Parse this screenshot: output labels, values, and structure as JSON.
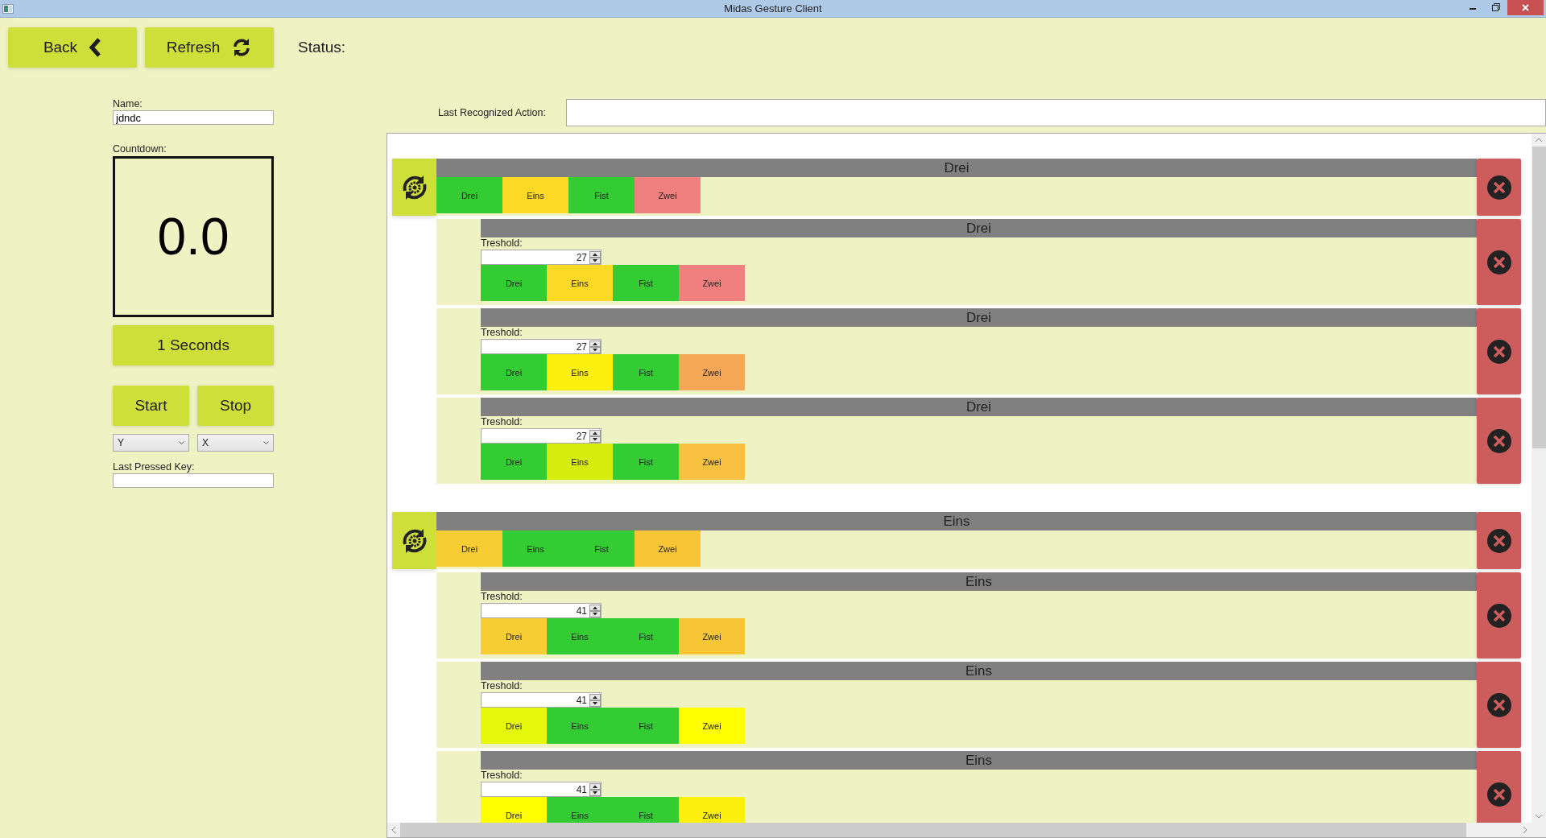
{
  "window": {
    "title": "Midas Gesture Client"
  },
  "toolbar": {
    "back_button": "Back",
    "refresh_button": "Refresh",
    "status_label": "Status:"
  },
  "left_panel": {
    "name_label": "Name:",
    "name_value": "jdndc",
    "countdown_label": "Countdown:",
    "countdown_value": "0.0",
    "duration_button": "1 Seconds",
    "start_button": "Start",
    "stop_button": "Stop",
    "dropdowns": [
      {
        "value": "Y"
      },
      {
        "value": "X"
      }
    ],
    "last_pressed_key_label": "Last Pressed Key:"
  },
  "last_recognized_action": {
    "label": "Last Recognized Action:"
  },
  "gestures": [
    {
      "title": "Drei",
      "cells": [
        {
          "label": "Drei",
          "color": "#33cc33"
        },
        {
          "label": "Eins",
          "color": "#fcd924"
        },
        {
          "label": "Fist",
          "color": "#33cc33"
        },
        {
          "label": "Zwei",
          "color": "#f08080"
        }
      ],
      "steps": [
        {
          "title": "Drei",
          "threshold_label": "Treshold:",
          "threshold": "27",
          "cells": [
            {
              "label": "Drei",
              "color": "#33cc33"
            },
            {
              "label": "Eins",
              "color": "#fcd924"
            },
            {
              "label": "Fist",
              "color": "#33cc33"
            },
            {
              "label": "Zwei",
              "color": "#f08080"
            }
          ]
        },
        {
          "title": "Drei",
          "threshold_label": "Treshold:",
          "threshold": "27",
          "cells": [
            {
              "label": "Drei",
              "color": "#33cc33"
            },
            {
              "label": "Eins",
              "color": "#fcf00c"
            },
            {
              "label": "Fist",
              "color": "#33cc33"
            },
            {
              "label": "Zwei",
              "color": "#f4a855"
            }
          ]
        },
        {
          "title": "Drei",
          "threshold_label": "Treshold:",
          "threshold": "27",
          "cells": [
            {
              "label": "Drei",
              "color": "#33cc33"
            },
            {
              "label": "Eins",
              "color": "#d7ed0e"
            },
            {
              "label": "Fist",
              "color": "#33cc33"
            },
            {
              "label": "Zwei",
              "color": "#f7c13f"
            }
          ]
        }
      ]
    },
    {
      "title": "Eins",
      "cells": [
        {
          "label": "Drei",
          "color": "#f8cc33"
        },
        {
          "label": "Eins",
          "color": "#33cc33"
        },
        {
          "label": "Fist",
          "color": "#33cc33"
        },
        {
          "label": "Zwei",
          "color": "#f7c637"
        }
      ],
      "steps": [
        {
          "title": "Eins",
          "threshold_label": "Treshold:",
          "threshold": "41",
          "cells": [
            {
              "label": "Drei",
              "color": "#f8cc33"
            },
            {
              "label": "Eins",
              "color": "#33cc33"
            },
            {
              "label": "Fist",
              "color": "#33cc33"
            },
            {
              "label": "Zwei",
              "color": "#f7c637"
            }
          ]
        },
        {
          "title": "Eins",
          "threshold_label": "Treshold:",
          "threshold": "41",
          "cells": [
            {
              "label": "Drei",
              "color": "#e6f809"
            },
            {
              "label": "Eins",
              "color": "#33cc33"
            },
            {
              "label": "Fist",
              "color": "#33cc33"
            },
            {
              "label": "Zwei",
              "color": "#ffff00"
            }
          ]
        },
        {
          "title": "Eins",
          "threshold_label": "Treshold:",
          "threshold": "41",
          "cells": [
            {
              "label": "Drei",
              "color": "#ffff00"
            },
            {
              "label": "Eins",
              "color": "#33cc33"
            },
            {
              "label": "Fist",
              "color": "#33cc33"
            },
            {
              "label": "Zwei",
              "color": "#fcf00c"
            }
          ]
        }
      ]
    }
  ]
}
